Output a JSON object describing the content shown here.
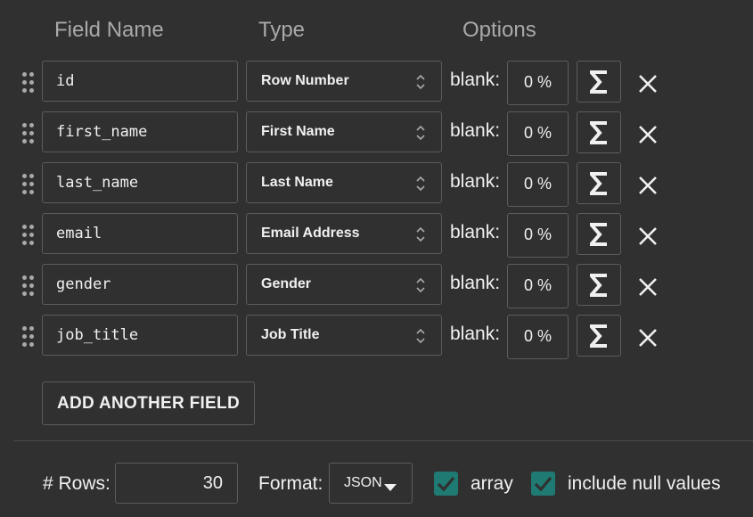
{
  "headers": {
    "field_name": "Field Name",
    "type": "Type",
    "options": "Options"
  },
  "fields": [
    {
      "name": "id",
      "type": "Row Number",
      "blank_label": "blank:",
      "blank_pct": "0 %"
    },
    {
      "name": "first_name",
      "type": "First Name",
      "blank_label": "blank:",
      "blank_pct": "0 %"
    },
    {
      "name": "last_name",
      "type": "Last Name",
      "blank_label": "blank:",
      "blank_pct": "0 %"
    },
    {
      "name": "email",
      "type": "Email Address",
      "blank_label": "blank:",
      "blank_pct": "0 %"
    },
    {
      "name": "gender",
      "type": "Gender",
      "blank_label": "blank:",
      "blank_pct": "0 %"
    },
    {
      "name": "job_title",
      "type": "Job Title",
      "blank_label": "blank:",
      "blank_pct": "0 %"
    }
  ],
  "add_field_label": "ADD ANOTHER FIELD",
  "footer": {
    "rows_label": "# Rows:",
    "rows_value": "30",
    "format_label": "Format:",
    "format_value": "JSON",
    "array_label": "array",
    "array_checked": true,
    "null_label": "include null values",
    "null_checked": true
  },
  "icons": {
    "drag": "drag-handle-icon",
    "chevron": "chevron-up-down-icon",
    "sigma": "sigma-icon",
    "delete": "close-icon",
    "caret": "caret-down-icon",
    "check": "checkmark-icon"
  },
  "colors": {
    "background": "#303030",
    "border": "#5c5c5c",
    "header_text": "#a9a9a9",
    "text": "#f0f0f0",
    "checkbox": "#1e7a73"
  }
}
